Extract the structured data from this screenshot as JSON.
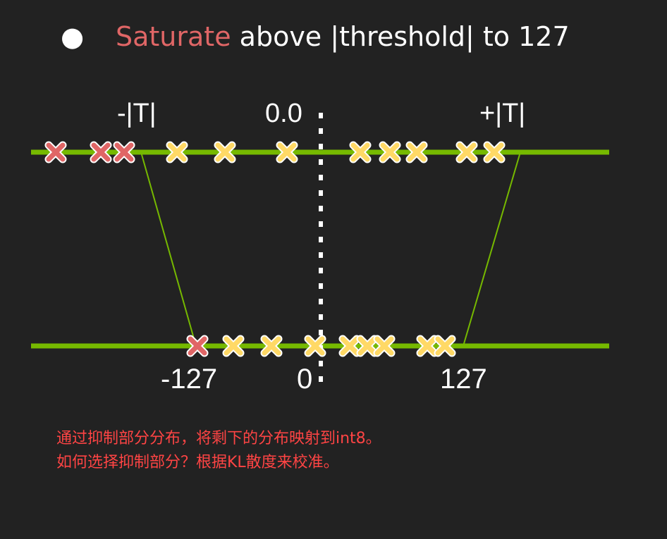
{
  "headline": {
    "bullet": "●",
    "highlight": "Saturate",
    "rest": " above |threshold| to 127"
  },
  "top_axis": {
    "left_label": "-|T|",
    "center_label": "0.0",
    "right_label": "+|T|"
  },
  "bottom_axis": {
    "left_label": "-127",
    "center_label": "0",
    "right_label": "127"
  },
  "notes": [
    "通过抑制部分分布，将剩下的分布映射到int8。",
    "如何选择抑制部分？根据KL散度来校准。"
  ],
  "colors": {
    "axis": "#76b900",
    "saturated_marker": "#e06666",
    "mapped_marker": "#ffd966",
    "note_text": "#ff4444"
  }
}
